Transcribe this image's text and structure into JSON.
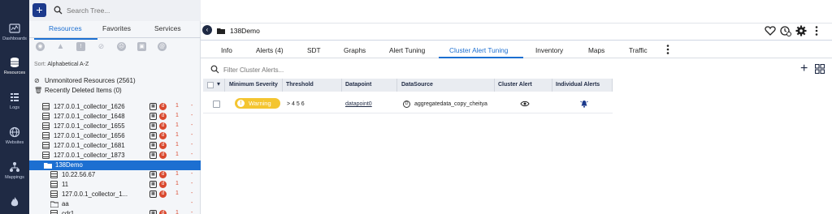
{
  "nav": {
    "items": [
      {
        "label": "Dashboards",
        "icon": "dashboard-icon"
      },
      {
        "label": "Resources",
        "icon": "resources-icon",
        "active": true
      },
      {
        "label": "Logs",
        "icon": "logs-icon"
      },
      {
        "label": "Websites",
        "icon": "websites-icon"
      },
      {
        "label": "Mappings",
        "icon": "mappings-icon"
      },
      {
        "label": "",
        "icon": "flame-icon"
      }
    ]
  },
  "tree": {
    "search_placeholder": "Search Tree...",
    "tabs": [
      "Resources",
      "Favorites",
      "Services"
    ],
    "sort_prefix": "Sort:",
    "sort_value": "Alphabetical A-Z",
    "unmonitored": "Unmonitored Resources (2561)",
    "recently_deleted": "Recently Deleted Items (0)",
    "items": [
      {
        "label": "127.0.0.1_collector_1626",
        "count": "1",
        "dash": "-"
      },
      {
        "label": "127.0.0.1_collector_1648",
        "count": "1",
        "dash": "-"
      },
      {
        "label": "127.0.0.1_collector_1655",
        "count": "1",
        "dash": "-"
      },
      {
        "label": "127.0.0.1_collector_1656",
        "count": "1",
        "dash": "-"
      },
      {
        "label": "127.0.0.1_collector_1681",
        "count": "1",
        "dash": "-"
      },
      {
        "label": "127.0.0.1_collector_1873",
        "count": "1",
        "dash": "-"
      },
      {
        "label": "138Demo",
        "selected": true
      },
      {
        "label": "10.22.56.67",
        "count": "1",
        "dash": "-"
      },
      {
        "label": "11",
        "count": "1",
        "dash": "-"
      },
      {
        "label": "127.0.0.1_collector_1...",
        "count": "1",
        "dash": "-"
      },
      {
        "label": "aa",
        "dash": "-"
      },
      {
        "label": "cdr1",
        "count": "1",
        "dash": "-"
      }
    ]
  },
  "header": {
    "title": "138Demo"
  },
  "tabs": [
    "Info",
    "Alerts (4)",
    "SDT",
    "Graphs",
    "Alert Tuning",
    "Cluster Alert Tuning",
    "Inventory",
    "Maps",
    "Traffic"
  ],
  "active_tab": "Cluster Alert Tuning",
  "filter_placeholder": "Filter Cluster Alerts...",
  "table": {
    "headers": [
      "Minimum Severity",
      "Threshold",
      "Datapoint",
      "DataSource",
      "Cluster Alert",
      "Individual Alerts"
    ],
    "rows": [
      {
        "severity": "Warning",
        "threshold": "> 4 5 6",
        "datapoint": "datapoint0",
        "datasource": "aggregatedata_copy_cheitya",
        "datasource_badge": "D"
      }
    ]
  },
  "colors": {
    "accent": "#1c6fd1",
    "nav_bg": "#1f2a44",
    "warning": "#f4c530",
    "critical": "#d9492f"
  }
}
